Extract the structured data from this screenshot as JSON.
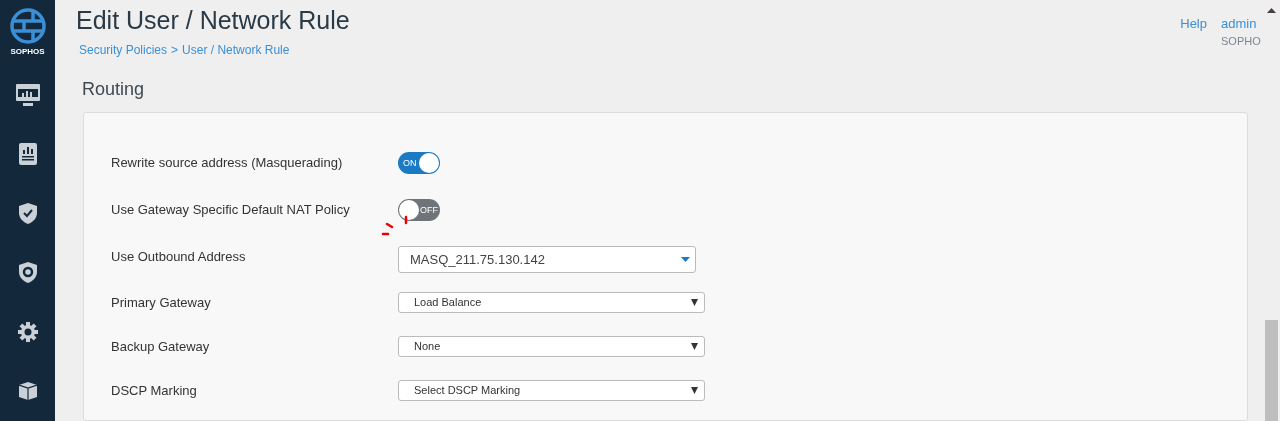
{
  "sidebar": {
    "logo_text": "SOPHOS",
    "items": [
      {
        "kind": "monitor",
        "selected": false
      },
      {
        "kind": "report",
        "selected": false
      },
      {
        "kind": "shield",
        "selected": false
      },
      {
        "kind": "protect",
        "selected": false
      },
      {
        "kind": "gear",
        "selected": false
      },
      {
        "kind": "box",
        "selected": false
      }
    ]
  },
  "header": {
    "title": "Edit User / Network Rule",
    "breadcrumb": [
      "Security Policies",
      "User / Network Rule"
    ],
    "breadcrumb_separator": ">",
    "help": "Help",
    "user": "admin",
    "org": "SOPHO"
  },
  "section": {
    "title": "Routing",
    "rows": [
      {
        "label": "Rewrite source address (Masquerading)",
        "kind": "toggle",
        "on": true,
        "text": "ON"
      },
      {
        "label": "Use Gateway Specific Default NAT Policy",
        "kind": "toggle",
        "on": false,
        "text": "OFF"
      },
      {
        "label": "Use Outbound Address",
        "kind": "combo",
        "value": "MASQ_211.75.130.142"
      },
      {
        "label": "Primary Gateway",
        "kind": "select",
        "value": "Load Balance"
      },
      {
        "label": "Backup Gateway",
        "kind": "select",
        "value": "None"
      },
      {
        "label": "DSCP Marking",
        "kind": "select",
        "value": "Select DSCP Marking"
      }
    ]
  }
}
